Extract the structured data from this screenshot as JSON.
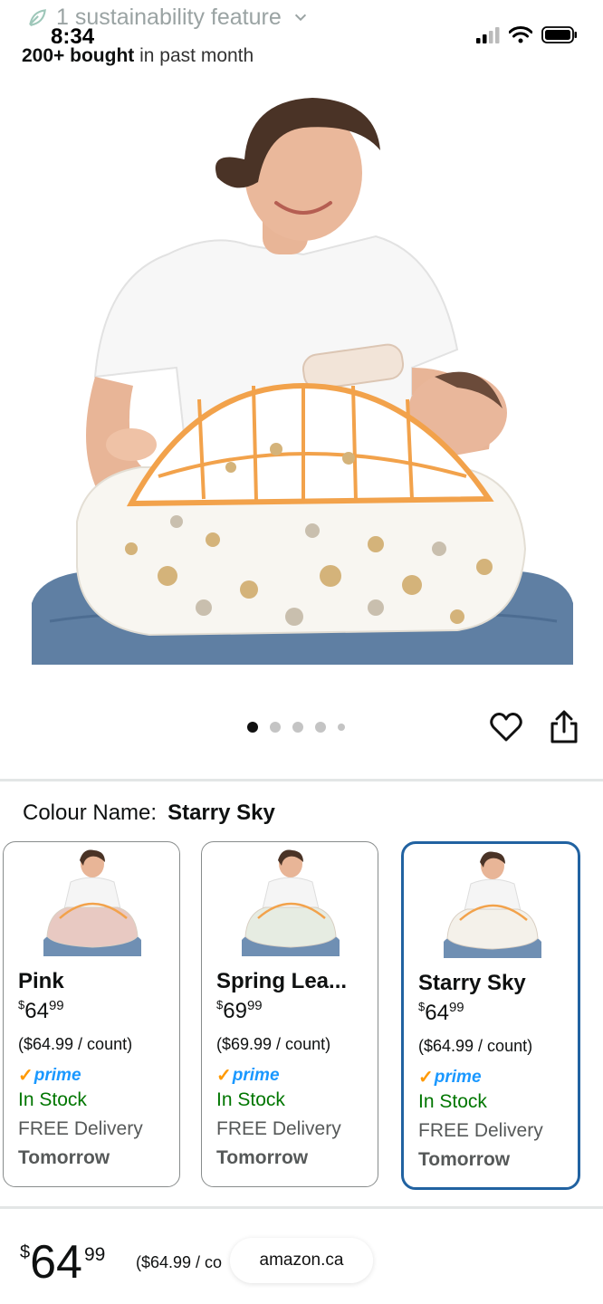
{
  "status_bar": {
    "time": "8:34"
  },
  "sustainability": {
    "label": "1 sustainability feature"
  },
  "social_proof": {
    "count": "200+ bought",
    "suffix": " in past month"
  },
  "gallery": {
    "image_count": 5,
    "active_index": 0
  },
  "colour": {
    "label": "Colour Name:",
    "value": "Starry Sky"
  },
  "variants": [
    {
      "name": "Pink",
      "currency": "$",
      "price_whole": "64",
      "price_cents": "99",
      "unit_price": "($64.99 / count)",
      "prime": "prime",
      "stock": "In Stock",
      "delivery": "FREE Delivery",
      "when": "Tomorrow",
      "selected": false,
      "cushion_color": "#e8c9c2"
    },
    {
      "name": "Spring Lea...",
      "currency": "$",
      "price_whole": "69",
      "price_cents": "99",
      "unit_price": "($69.99 / count)",
      "prime": "prime",
      "stock": "In Stock",
      "delivery": "FREE Delivery",
      "when": "Tomorrow",
      "selected": false,
      "cushion_color": "#e6ece2"
    },
    {
      "name": "Starry Sky",
      "currency": "$",
      "price_whole": "64",
      "price_cents": "99",
      "unit_price": "($64.99 / count)",
      "prime": "prime",
      "stock": "In Stock",
      "delivery": "FREE Delivery",
      "when": "Tomorrow",
      "selected": true,
      "cushion_color": "#f4f1ea"
    }
  ],
  "bottom_bar": {
    "currency": "$",
    "price_whole": "64",
    "price_cents": "99",
    "unit_price": "($64.99 / co"
  },
  "browser": {
    "url": "amazon.ca"
  },
  "colors": {
    "selected_border": "#2162a1",
    "in_stock": "#007600",
    "prime_blue": "#1a98ff",
    "prime_check": "#ff9900"
  }
}
